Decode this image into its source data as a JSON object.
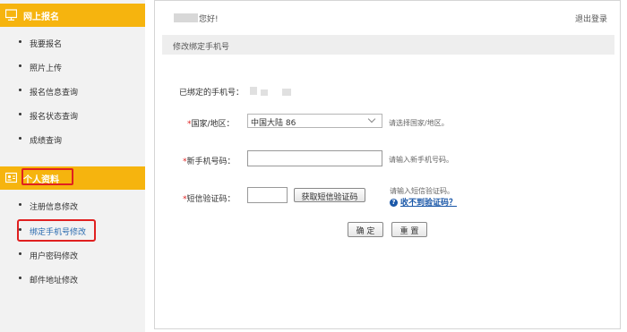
{
  "sidebar": {
    "section1": {
      "title": "网上报名",
      "icon": "monitor-icon"
    },
    "items1": [
      {
        "label": "我要报名"
      },
      {
        "label": "照片上传"
      },
      {
        "label": "报名信息查询"
      },
      {
        "label": "报名状态查询"
      },
      {
        "label": "成绩查询"
      }
    ],
    "section2": {
      "title": "个人资料",
      "icon": "id-card-icon"
    },
    "items2": [
      {
        "label": "注册信息修改"
      },
      {
        "label": "绑定手机号修改"
      },
      {
        "label": "用户密码修改"
      },
      {
        "label": "邮件地址修改"
      }
    ]
  },
  "header": {
    "greeting_suffix": "您好!",
    "logout": "退出登录"
  },
  "page_title": "修改绑定手机号",
  "form": {
    "bound_phone_label": "已绑定的手机号：",
    "country_label": "国家/地区：",
    "country_value": "中国大陆 86",
    "country_hint": "请选择国家/地区。",
    "new_phone_label": "新手机号码：",
    "new_phone_value": "",
    "new_phone_hint": "请输入新手机号码。",
    "sms_label": "短信验证码：",
    "sms_value": "",
    "get_code_button": "获取短信验证码",
    "sms_hint": "请输入短信验证码。",
    "no_code_link": "收不到验证码？",
    "required_mark": "*",
    "confirm_button": "确 定",
    "reset_button": "重 置"
  },
  "colors": {
    "accent": "#f6b40e",
    "highlight": "#e02020",
    "link": "#1a57a8"
  }
}
